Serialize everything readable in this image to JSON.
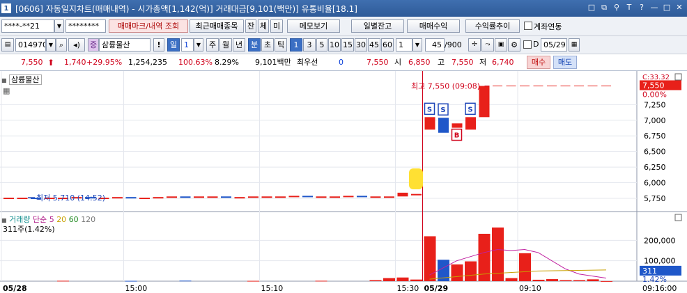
{
  "window": {
    "number": "1",
    "title": "[0606] 자동일지차트(매매내역) - 시가총액[1,142(억)] 거래대금[9,101(백만)] 유통비율[18.1]",
    "controls": [
      "□",
      "⧉",
      "⚲",
      "T",
      "?",
      "—",
      "□",
      "✕"
    ]
  },
  "toolbar1": {
    "account": "****-**21",
    "password": "********",
    "buttons": [
      "매매마크/내역 조회",
      "최근매매종목",
      "잔",
      "체",
      "미",
      "메모보기",
      "일별잔고",
      "매매수익",
      "수익률추이"
    ],
    "link_label": "계좌연동"
  },
  "toolbar2": {
    "code": "014970",
    "name": "삼륭물산",
    "excl": "!",
    "period_sel": "일",
    "period_num": "1",
    "periods": [
      "주",
      "월",
      "년",
      "분",
      "초",
      "틱"
    ],
    "intervals": [
      "1",
      "3",
      "5",
      "10",
      "15",
      "30",
      "45",
      "60"
    ],
    "unit": "1",
    "count": "45",
    "count_total": "/900",
    "d_label": "D",
    "date": "05/29"
  },
  "quote": {
    "price": "7,550",
    "change": "1,740",
    "rate": "+29.95%",
    "volume": "1,254,235",
    "vol_ratio": "100.63%",
    "turnover": "8.29%",
    "amount": "9,101백만",
    "hoga_label": "최우선",
    "hoga_val": "0",
    "price2": "7,550",
    "open_label": "시",
    "open": "6,850",
    "high_label": "고",
    "high": "7,550",
    "low_label": "저",
    "low": "6,740",
    "buy": "매수",
    "sell": "매도"
  },
  "chart_data": {
    "type": "candlestick",
    "stock_label": "삼륭물산",
    "annotations": {
      "high": "최고 7,550 (09:08)",
      "low": "최저 5,710 (14:52)",
      "right_top": "C:33.32",
      "right_price": "7,550",
      "right_pct": "0.00%"
    },
    "price_ticks": [
      7250,
      7000,
      6750,
      6500,
      6250,
      6000,
      5750
    ],
    "price_range": [
      5560,
      7700
    ],
    "candles": [
      {
        "o": 5760,
        "c": 5760
      },
      {
        "o": 5760,
        "c": 5760
      },
      {
        "o": 5760,
        "c": 5750
      },
      {
        "o": 5750,
        "c": 5760
      },
      {
        "o": 5760,
        "c": 5760
      },
      {
        "o": 5760,
        "c": 5770
      },
      {
        "o": 5770,
        "c": 5760
      },
      {
        "o": 5760,
        "c": 5760
      },
      {
        "o": 5760,
        "c": 5770
      },
      {
        "o": 5770,
        "c": 5760
      },
      {
        "o": 5760,
        "c": 5760
      },
      {
        "o": 5760,
        "c": 5770
      },
      {
        "o": 5770,
        "c": 5780
      },
      {
        "o": 5780,
        "c": 5770
      },
      {
        "o": 5770,
        "c": 5780
      },
      {
        "o": 5780,
        "c": 5780
      },
      {
        "o": 5780,
        "c": 5770
      },
      {
        "o": 5770,
        "c": 5770
      },
      {
        "o": 5770,
        "c": 5780
      },
      {
        "o": 5780,
        "c": 5780
      },
      {
        "o": 5780,
        "c": 5780
      },
      {
        "o": 5780,
        "c": 5790
      },
      {
        "o": 5790,
        "c": 5780
      },
      {
        "o": 5780,
        "c": 5780
      },
      {
        "o": 5780,
        "c": 5780
      },
      {
        "o": 5780,
        "c": 5790
      },
      {
        "o": 5790,
        "c": 5780
      },
      {
        "o": 5780,
        "c": 5780
      },
      {
        "o": 5780,
        "c": 5780
      },
      {
        "o": 5780,
        "c": 5840
      },
      {
        "o": 5810,
        "c": 5820
      },
      {
        "o": 6850,
        "c": 7050
      },
      {
        "o": 7040,
        "c": 6800
      },
      {
        "o": 6880,
        "c": 6950
      },
      {
        "o": 6850,
        "c": 7050
      },
      {
        "o": 7050,
        "c": 7550
      },
      {
        "o": 7550,
        "c": 7550
      },
      {
        "o": 7550,
        "c": 7550
      },
      {
        "o": 7550,
        "c": 7550
      },
      {
        "o": 7550,
        "c": 7550
      },
      {
        "o": 7550,
        "c": 7550
      },
      {
        "o": 7550,
        "c": 7550
      },
      {
        "o": 7550,
        "c": 7550
      },
      {
        "o": 7550,
        "c": 7550
      },
      {
        "o": 7550,
        "c": 7550
      }
    ],
    "markers": [
      {
        "index": 31,
        "label": "S",
        "type": "sell"
      },
      {
        "index": 32,
        "label": "S",
        "type": "sell"
      },
      {
        "index": 33,
        "label": "B",
        "type": "buy"
      },
      {
        "index": 34,
        "label": "S",
        "type": "sell"
      }
    ],
    "volume": {
      "legend": [
        "거래량",
        "단순",
        "5",
        "20",
        "60",
        "120"
      ],
      "current": "311주(1.42%)",
      "ticks": [
        200000,
        100000
      ],
      "range": [
        0,
        300000
      ],
      "right_val": "311",
      "right_pct": "1.42%",
      "bars": [
        {
          "i": 4,
          "v": 2000
        },
        {
          "i": 9,
          "v": 1500
        },
        {
          "i": 13,
          "v": 2500
        },
        {
          "i": 18,
          "v": 1500
        },
        {
          "i": 23,
          "v": 2000
        },
        {
          "i": 27,
          "v": 5000
        },
        {
          "i": 28,
          "v": 15000
        },
        {
          "i": 29,
          "v": 18000
        },
        {
          "i": 30,
          "v": 8000
        },
        {
          "i": 31,
          "v": 220000
        },
        {
          "i": 32,
          "v": 105000
        },
        {
          "i": 33,
          "v": 82000
        },
        {
          "i": 34,
          "v": 97000
        },
        {
          "i": 35,
          "v": 232000
        },
        {
          "i": 36,
          "v": 263000
        },
        {
          "i": 37,
          "v": 15000
        },
        {
          "i": 38,
          "v": 137000
        },
        {
          "i": 39,
          "v": 7000
        },
        {
          "i": 40,
          "v": 10000
        },
        {
          "i": 41,
          "v": 5000
        },
        {
          "i": 42,
          "v": 5000
        },
        {
          "i": 43,
          "v": 9000
        },
        {
          "i": 44,
          "v": 311
        }
      ],
      "ma5": [
        [
          31,
          30000
        ],
        [
          33,
          100000
        ],
        [
          35,
          140000
        ],
        [
          36,
          155000
        ],
        [
          37,
          150000
        ],
        [
          38,
          155000
        ],
        [
          39,
          140000
        ],
        [
          41,
          60000
        ],
        [
          42,
          35000
        ],
        [
          44,
          15000
        ]
      ],
      "ma20": [
        [
          31,
          10000
        ],
        [
          35,
          35000
        ],
        [
          39,
          50000
        ],
        [
          44,
          55000
        ]
      ]
    },
    "x_labels": [
      {
        "i": 0,
        "text": "05/28",
        "bold": true
      },
      {
        "i": 9,
        "text": "15:00",
        "bold": false
      },
      {
        "i": 19,
        "text": "15:10",
        "bold": false
      },
      {
        "i": 29,
        "text": "15:30",
        "bold": false
      },
      {
        "i": 31,
        "text": "05/29",
        "bold": true
      },
      {
        "i": 38,
        "text": "09:10",
        "bold": false
      }
    ],
    "axis_time": "09:16:00"
  }
}
